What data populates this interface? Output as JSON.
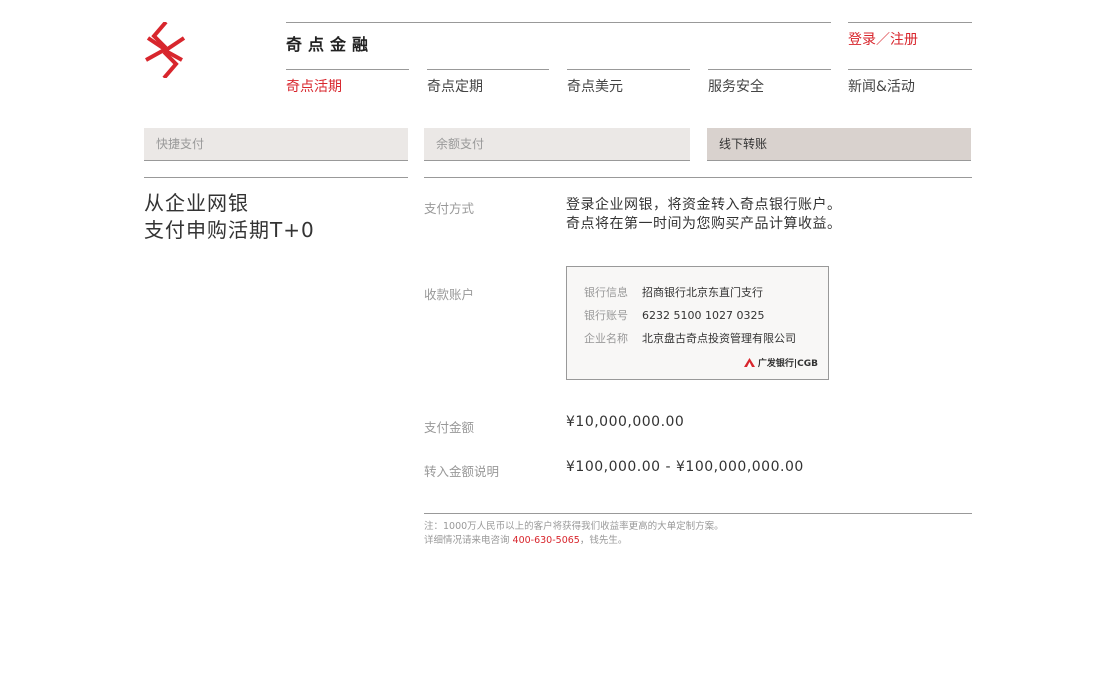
{
  "brand": {
    "name": "奇点金融"
  },
  "auth": {
    "login_label": "登录／注册"
  },
  "nav": {
    "items": [
      {
        "label": "奇点活期"
      },
      {
        "label": "奇点定期"
      },
      {
        "label": "奇点美元"
      },
      {
        "label": "服务安全"
      },
      {
        "label": "新闻&活动"
      }
    ],
    "active_index": 0
  },
  "tabs": {
    "items": [
      {
        "label": "快捷支付"
      },
      {
        "label": "余额支付"
      },
      {
        "label": "线下转账"
      }
    ],
    "active_index": 2
  },
  "headline": {
    "line1": "从企业网银",
    "line2": "支付申购活期T+0"
  },
  "details": {
    "method": {
      "label": "支付方式",
      "line1": "登录企业网银，将资金转入奇点银行账户。",
      "line2": "奇点将在第一时间为您购买产品计算收益。"
    },
    "account": {
      "label": "收款账户",
      "bank_info_key": "银行信息",
      "bank_info_value": "招商银行北京东直门支行",
      "account_no_key": "银行账号",
      "account_no_value": "6232 5100 1027 0325",
      "company_key": "企业名称",
      "company_value": "北京盘古奇点投资管理有限公司",
      "bank_logo_text": "广发银行|CGB"
    },
    "amount": {
      "label": "支付金额",
      "value": "¥10,000,000.00"
    },
    "range": {
      "label": "转入金额说明",
      "value": "¥100,000.00 - ¥100,000,000.00"
    }
  },
  "note": {
    "line1": "注：1000万人民币以上的客户将获得我们收益率更高的大单定制方案。",
    "line2_prefix": "详细情况请来电咨询 ",
    "phone": "400-630-5065",
    "line2_suffix": "，钱先生。"
  },
  "colors": {
    "accent": "#d8262d",
    "tab_bg": "#ebe8e6",
    "tab_active_bg": "#d9d2ce"
  }
}
